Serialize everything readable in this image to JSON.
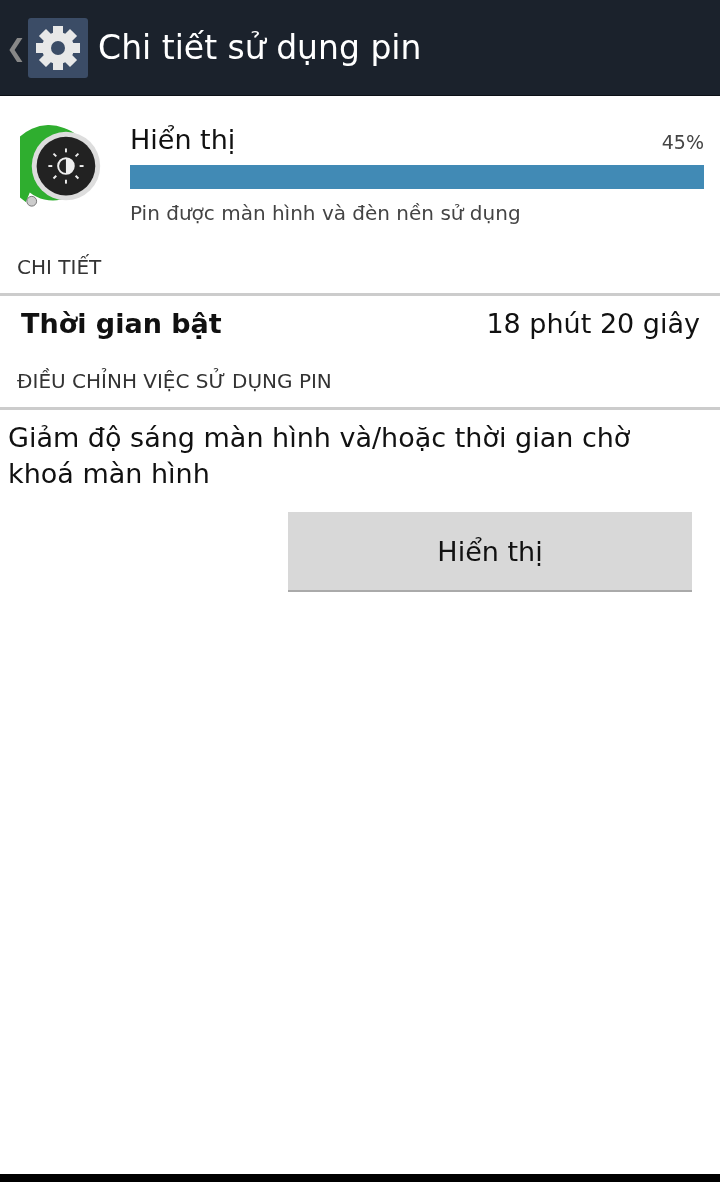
{
  "action_bar": {
    "back": "❮",
    "title": "Chi tiết sử dụng pin"
  },
  "usage": {
    "label": "Hiển thị",
    "percent": "45%",
    "level": 1,
    "description": "Pin được màn hình và đèn nền sử dụng"
  },
  "details": {
    "header": "CHI TIẾT",
    "rows": [
      {
        "label": "Thời gian bật",
        "value": "18 phút 20 giây"
      }
    ]
  },
  "adjust": {
    "header": "ĐIỀU CHỈNH VIỆC SỬ DỤNG PIN",
    "text": "Giảm độ sáng màn hình và/hoặc thời gian chờ khoá màn hình",
    "button": "Hiển thị"
  }
}
